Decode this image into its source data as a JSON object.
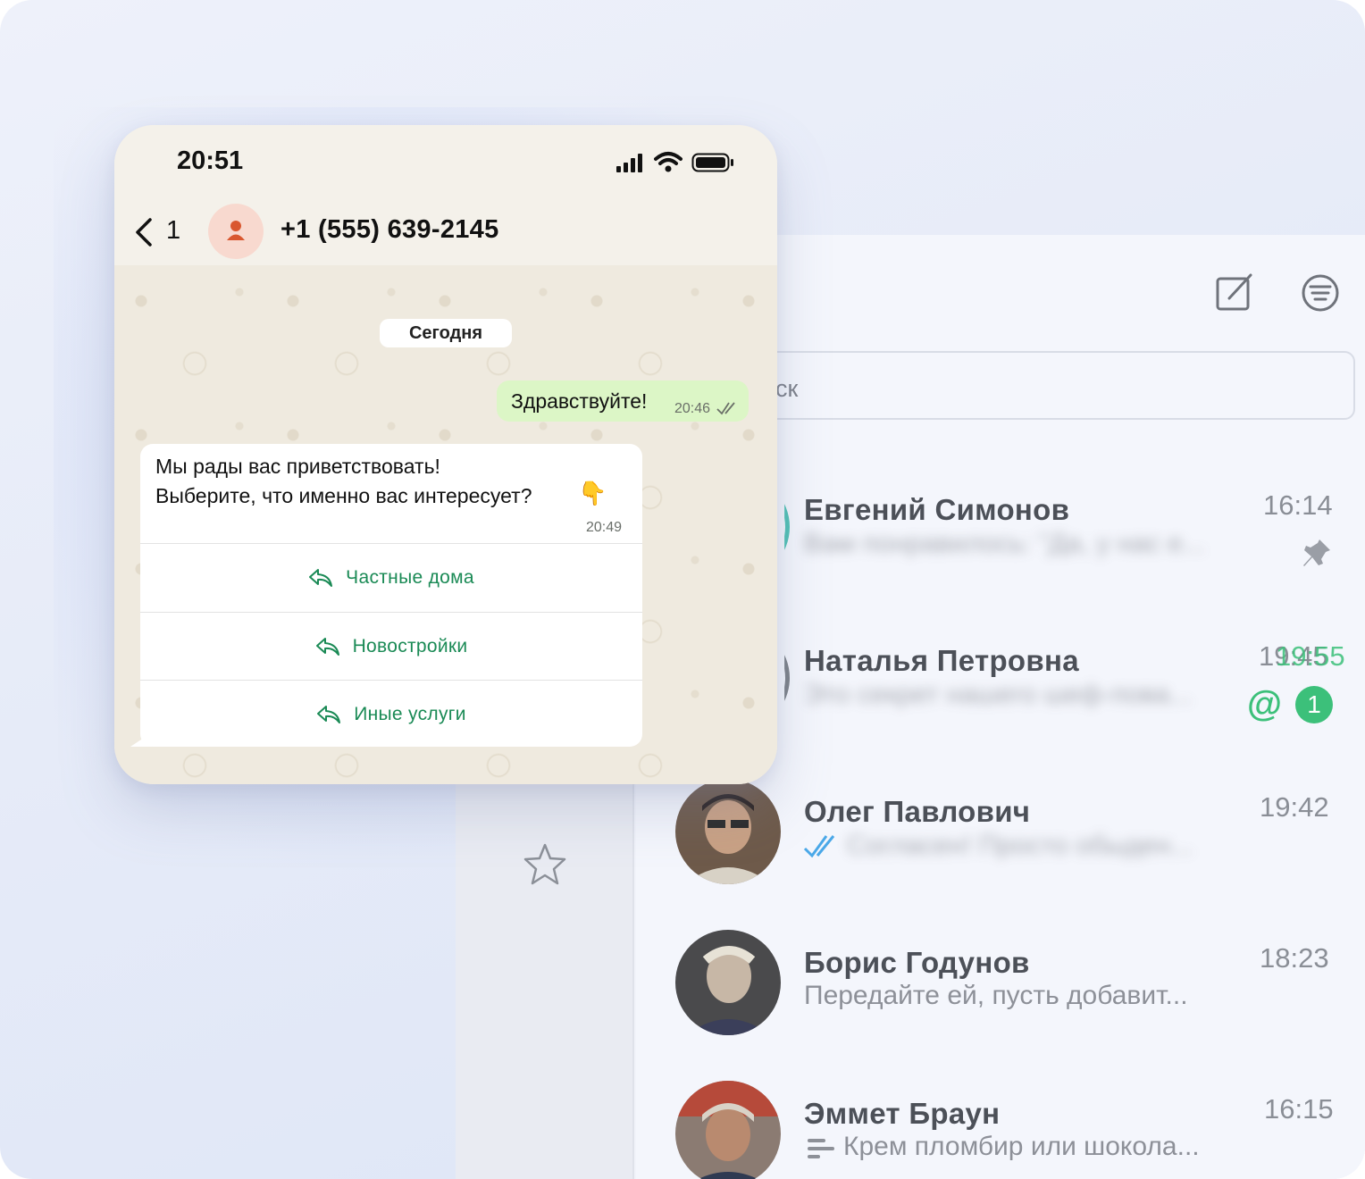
{
  "messenger": {
    "search": {
      "text": "ск"
    },
    "chats": [
      {
        "name": "Евгений Симонов",
        "time": "16:14",
        "preview": "Вам понравилось: \"Да, у нас е...",
        "pinned": true
      },
      {
        "name": "Наталья Петровна",
        "time": "19:45",
        "time_overlay": "19:55",
        "preview": "Это секрет нашего шеф-пова...",
        "unread": "1",
        "mention": "@"
      },
      {
        "name": "Олег Павлович",
        "time": "19:42",
        "preview": "Согласен! Просто обыден..."
      },
      {
        "name": "Борис Годунов",
        "time": "18:23",
        "preview": "Передайте ей, пусть добавит..."
      },
      {
        "name": "Эммет Браун",
        "time": "16:15",
        "preview": "Крем пломбир или шокола..."
      }
    ]
  },
  "phone": {
    "status_time": "20:51",
    "back_count": "1",
    "contact": "+1 (555) 639-2145",
    "date_label": "Сегодня",
    "outgoing": {
      "text": "Здравствуйте!",
      "time": "20:46"
    },
    "incoming": {
      "line1": "Мы рады вас приветствовать!",
      "line2": "Выберите, что именно вас интересует?",
      "emoji": "👇",
      "time": "20:49",
      "options": [
        "Частные дома",
        "Новостройки",
        "Иные услуги"
      ]
    }
  },
  "colors": {
    "accent": "#3cc07a",
    "option_text": "#1a8a55",
    "outgoing_bubble": "#dcf6c6"
  }
}
